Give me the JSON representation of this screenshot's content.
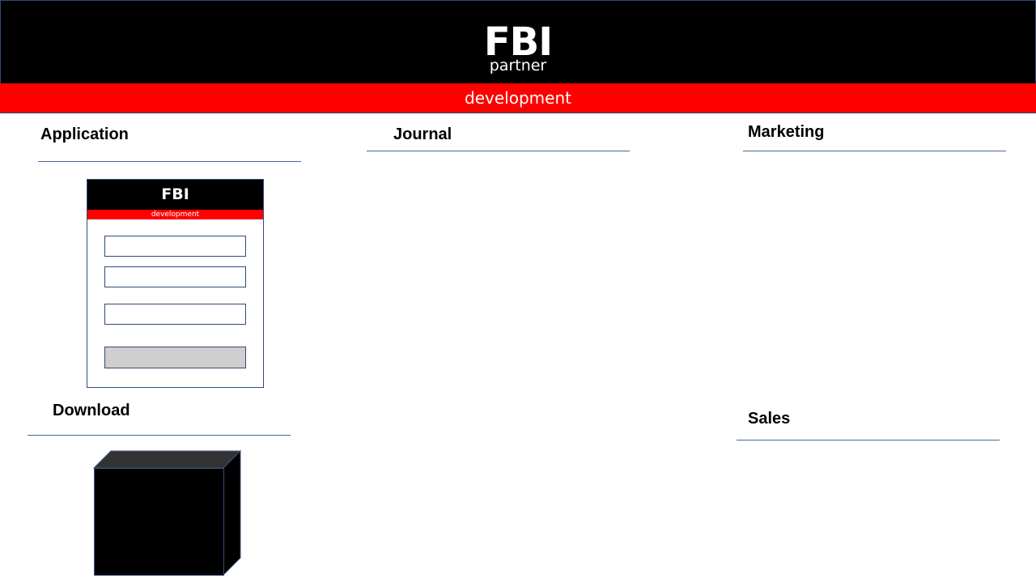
{
  "header": {
    "title": "FBI",
    "subtitle": "partner",
    "band_label": "development"
  },
  "sections": {
    "application": "Application",
    "journal": "Journal",
    "marketing": "Marketing",
    "download": "Download",
    "sales": "Sales"
  },
  "mini_app": {
    "title": "FBI",
    "band_label": "development"
  },
  "colors": {
    "header_bg": "#000000",
    "band_bg": "#ff0000",
    "rule": "#4a6791",
    "button_bg": "#d0cece"
  }
}
